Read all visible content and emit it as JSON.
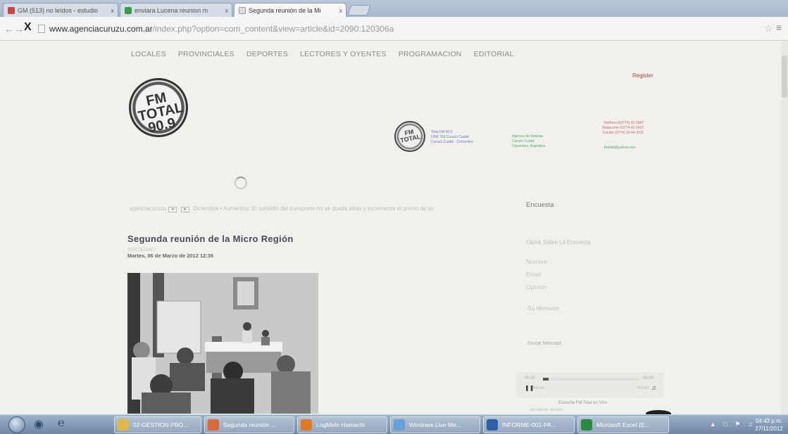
{
  "tabs": [
    {
      "label": "GM (513) no leídos - estudio",
      "close": "x"
    },
    {
      "label": "enviara Lucena reunion m",
      "close": "x"
    },
    {
      "label": "Segunda reunión de la Mi",
      "close": "x"
    }
  ],
  "browser": {
    "stop_icon": "X",
    "url_domain": "www.agenciacuruzu.com.ar",
    "url_path": "/index.php?option=com_content&view=article&id=2090:120306a"
  },
  "nav": {
    "items": [
      "LOCALES",
      "PROVINCIALES",
      "DEPORTES",
      "LECTORES Y OYENTES",
      "PROGRAMACION",
      "EDITORIAL"
    ]
  },
  "header": {
    "register": "Register",
    "logo_text": "FM TOTAL 90.9",
    "logo_small_text": "FM TOTAL",
    "col_blue": [
      "Total FM 90.9",
      "LRM 703 Curuzú Cuatiá",
      "Curuzú Cuatiá - Corrientes"
    ],
    "col_green": [
      "Agencia de Noticias",
      "Curuzú Cuatiá",
      "Corrientes, Argentina"
    ],
    "col_red": [
      "Teléfono (03774) 42-2987",
      "Redacción 03774 42-2410",
      "Celular (3774) 15-44-3311"
    ],
    "col_email": "fmtotal@yahoo.com"
  },
  "ticker": {
    "site": "agenciacuruzu",
    "prev": "◄",
    "next": "►",
    "text": "Diciembre • Aumentos: El subsidio del transporte no se queda atrás y incrementa el precio de su"
  },
  "article": {
    "title": "Segunda reunión de la Micro Región",
    "section": "SOCIEDAD",
    "date": "Martes, 06 de Marzo de 2012 12:36"
  },
  "sidebar": {
    "encuesta": "Encuesta",
    "question": "Opinà Sobre La Encuesta",
    "nombre": "Nombre",
    "email": "Email",
    "opinion": "Opinión",
    "mensaje": "Su Mensaje",
    "enviar": "Enviar Mensaje",
    "player_time_start": "00:10",
    "player_time_end": "00:00",
    "player_progress": 0.06,
    "pause_label": "PAUSE",
    "audio_label": "AUDIO",
    "listen": "Escucha FM Total en Vivo",
    "listen_sub": "por Internet, también"
  },
  "taskbar": {
    "tasks": [
      {
        "label": "02-GESTION PRO...",
        "color": "#e0b84a"
      },
      {
        "label": "Segunda reunión ...",
        "color": "#d96b3a"
      },
      {
        "label": "LogMeIn Hamachi",
        "color": "#e07a2a"
      },
      {
        "label": "Windows Live Me...",
        "color": "#6aa0d8"
      },
      {
        "label": "INFORME-001-PA...",
        "color": "#2f5fa8"
      },
      {
        "label": "Microsoft Excel (E...",
        "color": "#2a8a3e"
      }
    ],
    "time": "04:43 p.m.",
    "date": "27/11/2012"
  }
}
